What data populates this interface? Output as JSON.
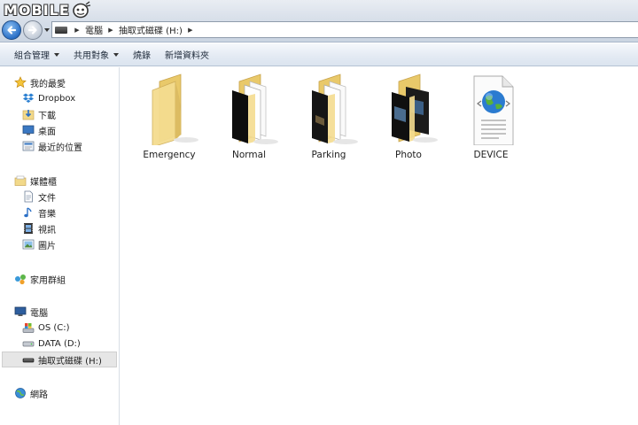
{
  "watermark": {
    "text": "MOBILE"
  },
  "address": {
    "crumbs": [
      "電腦",
      "抽取式磁碟 (H:)"
    ]
  },
  "toolbar": {
    "organize": "組合管理",
    "share": "共用對象",
    "burn": "燒錄",
    "new_folder": "新增資料夾"
  },
  "sidebar": {
    "favorites": "我的最愛",
    "dropbox": "Dropbox",
    "downloads": "下載",
    "desktop": "桌面",
    "recent": "最近的位置",
    "libraries": "媒體櫃",
    "documents": "文件",
    "music": "音樂",
    "videos": "視訊",
    "pictures": "圖片",
    "homegroup": "家用群組",
    "computer": "電腦",
    "drive_c": "OS (C:)",
    "drive_d": "DATA (D:)",
    "drive_h": "抽取式磁碟 (H:)",
    "network": "網路"
  },
  "files": [
    {
      "name": "Emergency",
      "icon": "empty-folder-icon"
    },
    {
      "name": "Normal",
      "icon": "folder-with-documents-icon"
    },
    {
      "name": "Parking",
      "icon": "folder-with-documents-icon"
    },
    {
      "name": "Photo",
      "icon": "folder-with-photos-icon"
    },
    {
      "name": "DEVICE",
      "icon": "web-document-icon"
    }
  ],
  "colors": {
    "folder": "#f2d98a",
    "selection": "#e6e6e6",
    "accent": "#2a6fc6"
  }
}
